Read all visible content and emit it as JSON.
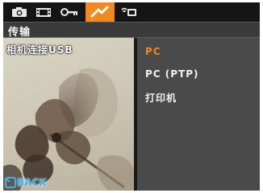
{
  "tabs": [
    {
      "icon": "camera-icon",
      "active": false
    },
    {
      "icon": "film-icon",
      "active": false
    },
    {
      "icon": "key-icon",
      "active": false
    },
    {
      "icon": "wrench-icon",
      "active": true
    },
    {
      "icon": "wifi-icon",
      "active": false
    }
  ],
  "header": {
    "title": "传输"
  },
  "preview": {
    "usb_label": "相机连接USB",
    "back_label": "BACK"
  },
  "menu": {
    "items": [
      {
        "label": "PC",
        "selected": true
      },
      {
        "label": "PC (PTP)",
        "selected": false
      },
      {
        "label": "打印机",
        "selected": false
      }
    ]
  },
  "colors": {
    "accent": "#f08a1c",
    "back": "#3fb0e8"
  }
}
